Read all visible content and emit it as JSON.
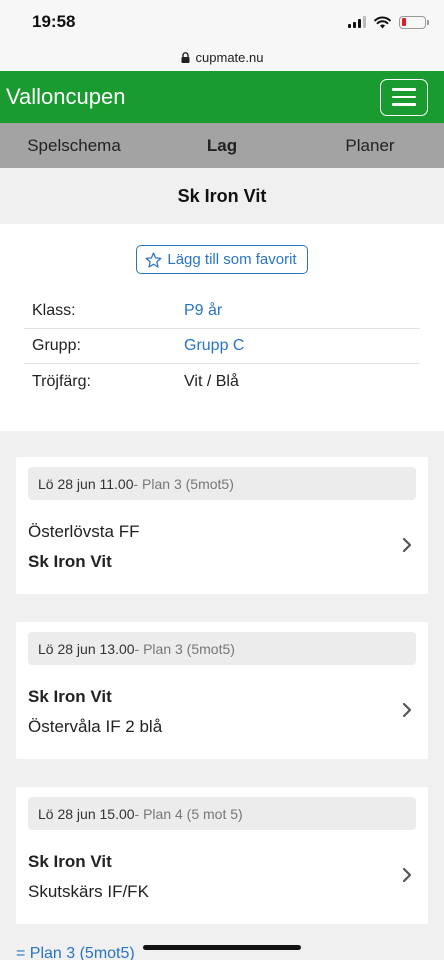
{
  "status": {
    "time": "19:58"
  },
  "browser": {
    "url": "cupmate.nu"
  },
  "app": {
    "title": "Valloncupen"
  },
  "tabs": [
    {
      "label": "Spelschema"
    },
    {
      "label": "Lag"
    },
    {
      "label": "Planer"
    }
  ],
  "team": {
    "name": "Sk Iron Vit"
  },
  "favorite_label": "Lägg till som favorit",
  "info": {
    "klass_label": "Klass:",
    "klass_value": "P9 år",
    "grupp_label": "Grupp:",
    "grupp_value": "Grupp C",
    "trojfarg_label": "Tröjfärg:",
    "trojfarg_value": "Vit / Blå"
  },
  "matches": [
    {
      "time": "Lö 28 jun 11.00",
      "plan": " - Plan 3 (5mot5)",
      "home": "Österlövsta FF",
      "away": "Sk Iron Vit"
    },
    {
      "time": "Lö 28 jun 13.00",
      "plan": " - Plan 3 (5mot5)",
      "home": "Sk Iron Vit",
      "away": "Östervåla IF 2 blå"
    },
    {
      "time": "Lö 28 jun 15.00",
      "plan": " - Plan 4 (5 mot 5)",
      "home": "Sk Iron Vit",
      "away": "Skutskärs IF/FK"
    }
  ],
  "footer": {
    "link": "= Plan 3 (5mot5)"
  },
  "colors": {
    "header_green": "#1a9b2f",
    "link_blue": "#2a75c2",
    "tabs_gray": "#a3a3a3"
  }
}
